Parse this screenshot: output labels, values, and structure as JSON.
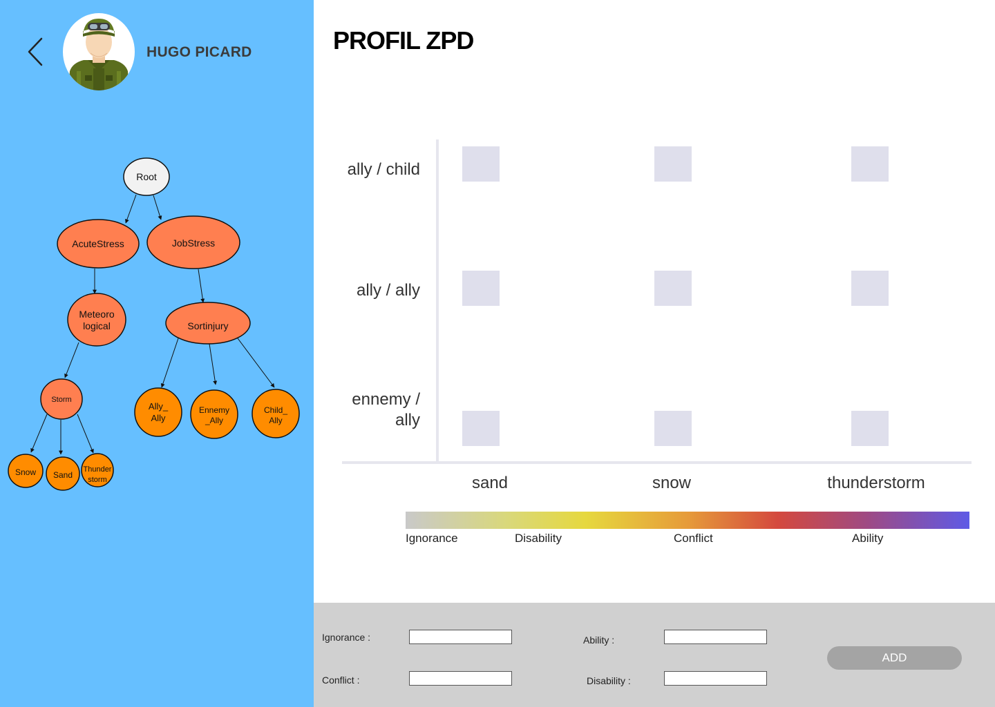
{
  "user": {
    "name": "HUGO PICARD"
  },
  "tree": {
    "nodes": {
      "root": "Root",
      "acute": "AcuteStress",
      "job": "JobStress",
      "meteo_l1": "Meteoro",
      "meteo_l2": "logical",
      "sortinjury": "Sortinjury",
      "storm": "Storm",
      "ally_ally_l1": "Ally_",
      "ally_ally_l2": "Ally",
      "ennemy_ally_l1": "Ennemy",
      "ennemy_ally_l2": "_Ally",
      "child_ally_l1": "Child_",
      "child_ally_l2": "Ally",
      "snow": "Snow",
      "sand": "Sand",
      "thunder_l1": "Thunder",
      "thunder_l2": "storm"
    },
    "colors": {
      "root": "#f2f2f2",
      "coral": "#ff7f50",
      "orange": "#ff8c00",
      "edge": "#111111"
    }
  },
  "profile": {
    "title": "PROFIL ZPD",
    "rows": [
      "ally / child",
      "ally / ally",
      "ennemy / ally"
    ],
    "columns": [
      "sand",
      "snow",
      "thunderstorm"
    ]
  },
  "scale": {
    "labels": [
      "Ignorance",
      "Disability",
      "Conflict",
      "Ability"
    ],
    "colors": [
      "#c9c9c9",
      "#e6d83e",
      "#d4493e",
      "#5e5ae6"
    ]
  },
  "form": {
    "ignorance_label": "Ignorance :",
    "ability_label": "Ability :",
    "conflict_label": "Conflict :",
    "disability_label": "Disability :",
    "ignorance_value": "",
    "ability_value": "",
    "conflict_value": "",
    "disability_value": "",
    "add_label": "ADD"
  },
  "icons": {
    "back": "chevron-left-icon",
    "avatar": "soldier-avatar"
  }
}
